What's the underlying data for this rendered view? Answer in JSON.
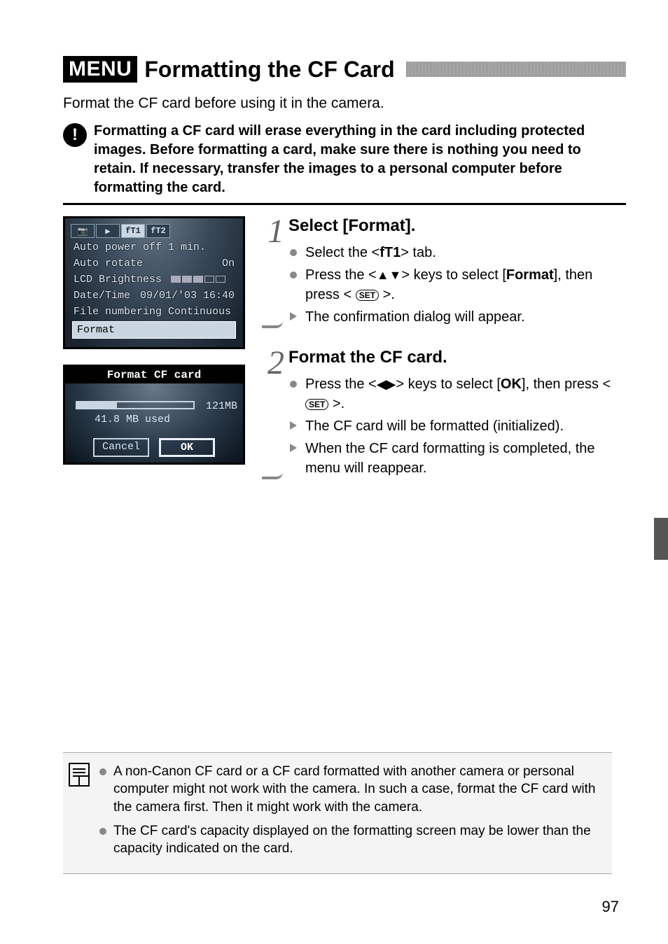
{
  "header": {
    "badge": "MENU",
    "title": "Formatting the CF Card"
  },
  "intro": "Format the CF card before using it in the camera.",
  "warning": "Formatting a CF card will erase everything in the card including protected images. Before formatting a card, make sure there is nothing you need to retain. If necessary, transfer the images to a personal computer before formatting the card.",
  "lcd_menu": {
    "tabs": [
      "📷",
      "▶",
      "fT1",
      "fT2"
    ],
    "active_tab_index": 2,
    "items": [
      {
        "label": "Auto power off",
        "value": "1 min."
      },
      {
        "label": "Auto rotate",
        "value": "On"
      },
      {
        "label": "LCD Brightness",
        "value": ""
      },
      {
        "label": "Date/Time",
        "value": "09/01/'03 16:40"
      },
      {
        "label": "File numbering",
        "value": "Continuous"
      },
      {
        "label": "Format",
        "value": "",
        "selected": true
      }
    ]
  },
  "lcd_format": {
    "title": "Format CF card",
    "capacity": "121MB",
    "used": "41.8 MB used",
    "cancel": "Cancel",
    "ok": "OK"
  },
  "steps": [
    {
      "num": "1",
      "title": "Select [Format].",
      "items": [
        {
          "type": "dot",
          "html": "Select the <<b>fT1</b>> tab."
        },
        {
          "type": "dot",
          "html": "Press the <<span class='updown'>▲▼</span>> keys to select [<b>Format</b>], then press < <span class='setbtn'>SET</span> >."
        },
        {
          "type": "tri",
          "html": "The confirmation dialog will appear."
        }
      ]
    },
    {
      "num": "2",
      "title": "Format the CF card.",
      "items": [
        {
          "type": "dot",
          "html": "Press the <<span class='lr'>◀▶</span>> keys to select [<b>OK</b>], then press < <span class='setbtn'>SET</span> >."
        },
        {
          "type": "tri",
          "html": "The CF card will be formatted (initialized)."
        },
        {
          "type": "tri",
          "html": "When the CF card formatting is completed, the menu will reappear."
        }
      ]
    }
  ],
  "notes": [
    "A non-Canon CF card or a CF card formatted with another camera or personal computer might not work with the camera. In such a case, format the CF card with the camera first. Then it might work with the camera.",
    "The CF card's capacity displayed on the formatting screen may be lower than the capacity indicated on the card."
  ],
  "page_number": "97"
}
